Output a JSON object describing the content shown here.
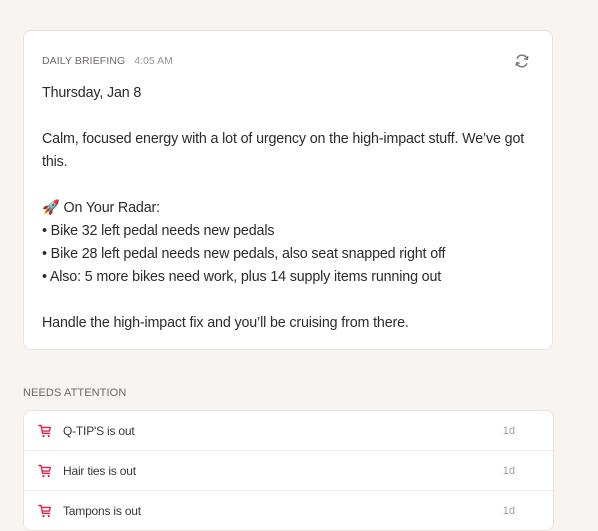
{
  "briefing": {
    "title": "DAILY BRIEFING",
    "time": "4:05 AM",
    "date": "Thursday, Jan 8",
    "intro": "Calm, focused energy with a lot of urgency on the high-impact stuff. We’ve got this.",
    "radar_emoji": "🚀",
    "radar_heading": "On Your Radar:",
    "radar_items": [
      "• Bike 32 left pedal needs new pedals",
      "• Bike 28 left pedal needs new pedals, also seat snapped right off",
      "• Also: 5 more bikes need work, plus 14 supply items running out"
    ],
    "closing": "Handle the high-impact fix and you’ll be cruising from there."
  },
  "attention": {
    "label": "NEEDS ATTENTION",
    "items": [
      {
        "label": "Q-TIP'S is out",
        "age": "1d",
        "icon": "cart-icon"
      },
      {
        "label": "Hair ties is out",
        "age": "1d",
        "icon": "cart-icon"
      },
      {
        "label": "Tampons is out",
        "age": "1d",
        "icon": "cart-icon"
      }
    ]
  },
  "colors": {
    "background": "#f7f4f2",
    "card": "#ffffff",
    "alert_icon": "#e0234e",
    "muted_text": "#6f6864"
  },
  "icons": {
    "refresh": "refresh-icon",
    "alert": "cart-icon",
    "radar": "rocket-emoji"
  }
}
